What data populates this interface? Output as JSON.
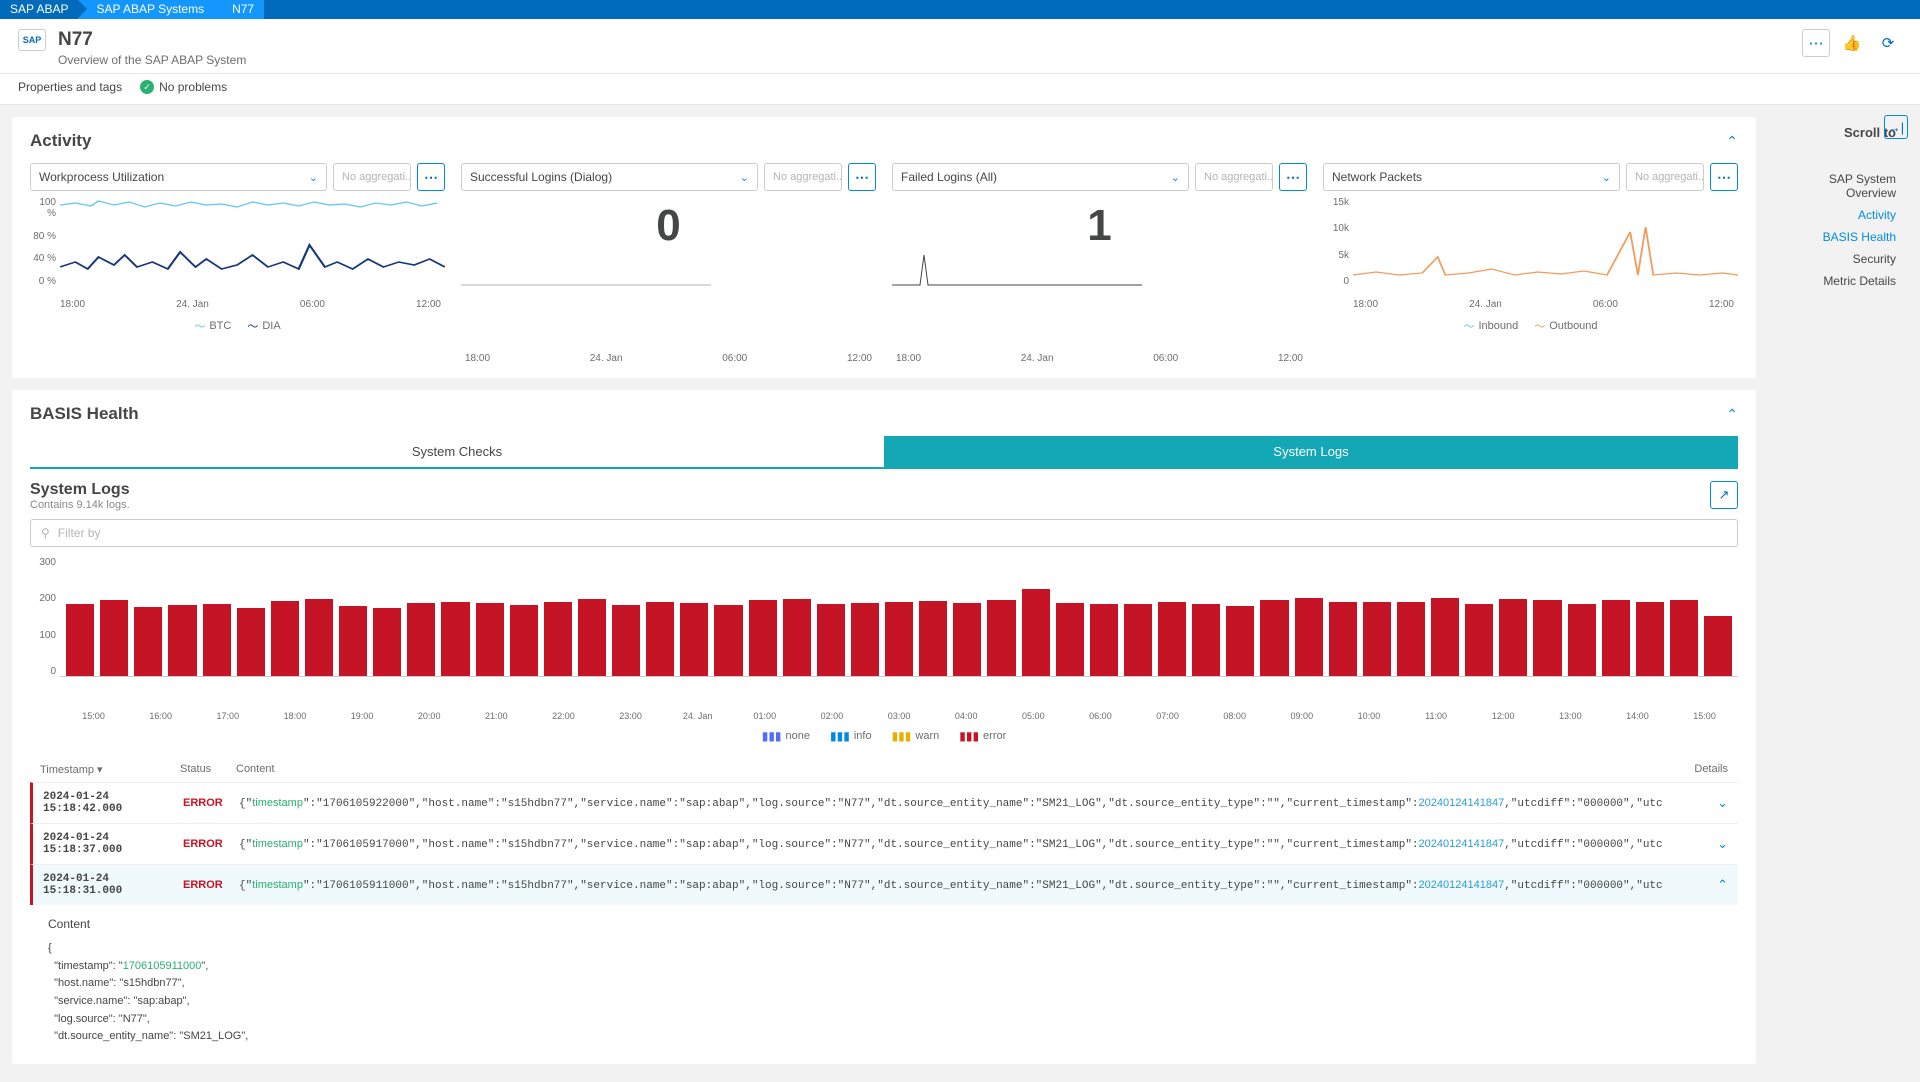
{
  "breadcrumbs": [
    "SAP ABAP",
    "SAP ABAP Systems",
    "N77"
  ],
  "header": {
    "icon_text": "SAP",
    "title": "N77",
    "subtitle": "Overview of the SAP ABAP System"
  },
  "props": {
    "link": "Properties and tags",
    "no_problems": "No problems"
  },
  "scroll_to": {
    "title": "Scroll to",
    "items": [
      "SAP System Overview",
      "Activity",
      "BASIS Health",
      "Security",
      "Metric Details"
    ],
    "active": [
      1,
      2
    ]
  },
  "activity": {
    "title": "Activity",
    "cards": [
      {
        "metric": "Workprocess Utilization",
        "agg_placeholder": "No aggregati...",
        "y_ticks": [
          "100 %",
          "80 %",
          "40 %",
          "0 %"
        ],
        "x_ticks": [
          "18:00",
          "24. Jan",
          "06:00",
          "12:00"
        ],
        "legend": [
          {
            "label": "BTC",
            "color": "#5ec7f2"
          },
          {
            "label": "DIA",
            "color": "#14367a"
          }
        ],
        "type": "line"
      },
      {
        "metric": "Successful Logins (Dialog)",
        "agg_placeholder": "No aggregati...",
        "big_value": "0",
        "x_ticks": [
          "18:00",
          "24. Jan",
          "06:00",
          "12:00"
        ],
        "type": "sparkline-flat"
      },
      {
        "metric": "Failed Logins (All)",
        "agg_placeholder": "No aggregati...",
        "big_value": "1",
        "x_ticks": [
          "18:00",
          "24. Jan",
          "06:00",
          "12:00"
        ],
        "type": "sparkline-spike"
      },
      {
        "metric": "Network Packets",
        "agg_placeholder": "No aggregati...",
        "y_ticks": [
          "15k",
          "10k",
          "5k",
          "0"
        ],
        "x_ticks": [
          "18:00",
          "24. Jan",
          "06:00",
          "12:00"
        ],
        "legend": [
          {
            "label": "Inbound",
            "color": "#5ec7f2"
          },
          {
            "label": "Outbound",
            "color": "#f29b5e"
          }
        ],
        "type": "line"
      }
    ]
  },
  "basis": {
    "title": "BASIS Health",
    "tabs": [
      "System Checks",
      "System Logs"
    ],
    "active_tab": 1,
    "syslogs_title": "System Logs",
    "syslogs_sub": "Contains 9.14k logs.",
    "filter_placeholder": "Filter by",
    "legend": [
      {
        "label": "none",
        "color": "#526cff"
      },
      {
        "label": "info",
        "color": "#008cdb"
      },
      {
        "label": "warn",
        "color": "#e6b000"
      },
      {
        "label": "error",
        "color": "#c41425"
      }
    ],
    "columns": [
      "Timestamp",
      "Status",
      "Content",
      "Details"
    ]
  },
  "chart_data": {
    "type": "bar",
    "ylim": [
      0,
      300
    ],
    "y_ticks": [
      300,
      200,
      100,
      0
    ],
    "categories": [
      "15:00",
      "16:00",
      "17:00",
      "18:00",
      "19:00",
      "20:00",
      "21:00",
      "22:00",
      "23:00",
      "24. Jan",
      "01:00",
      "02:00",
      "03:00",
      "04:00",
      "05:00",
      "06:00",
      "07:00",
      "08:00",
      "09:00",
      "10:00",
      "11:00",
      "12:00",
      "13:00",
      "14:00",
      "15:00"
    ],
    "values": [
      180,
      190,
      172,
      178,
      180,
      170,
      188,
      192,
      175,
      170,
      182,
      185,
      182,
      178,
      185,
      192,
      178,
      185,
      182,
      178,
      190,
      192,
      180,
      182,
      185,
      188,
      182,
      190,
      218,
      182,
      180,
      180,
      185,
      180,
      175,
      190,
      195,
      185,
      185,
      185,
      195,
      180,
      192,
      190,
      180,
      190,
      185,
      190,
      150
    ],
    "series_color": "#c41425"
  },
  "logs": [
    {
      "ts": "2024-01-24 15:18:42.000",
      "status": "ERROR",
      "content_ts": "1706105922000",
      "curr_ts": "20240124141847",
      "expanded": false
    },
    {
      "ts": "2024-01-24 15:18:37.000",
      "status": "ERROR",
      "content_ts": "1706105917000",
      "curr_ts": "20240124141847",
      "expanded": false
    },
    {
      "ts": "2024-01-24 15:18:31.000",
      "status": "ERROR",
      "content_ts": "1706105911000",
      "curr_ts": "20240124141847",
      "expanded": true
    }
  ],
  "log_common": {
    "host": "s15hdbn77",
    "service": "sap:abap",
    "source": "N77",
    "entity_name": "SM21_LOG",
    "entity_type": "",
    "utcdiff": "000000",
    "tail": "utc"
  },
  "detail": {
    "label": "Content",
    "timestamp": "1706105911000",
    "host": "s15hdbn77",
    "service": "sap:abap",
    "source": "N77",
    "entity_name": "SM21_LOG",
    "entity_type_trunc": "\"\""
  }
}
